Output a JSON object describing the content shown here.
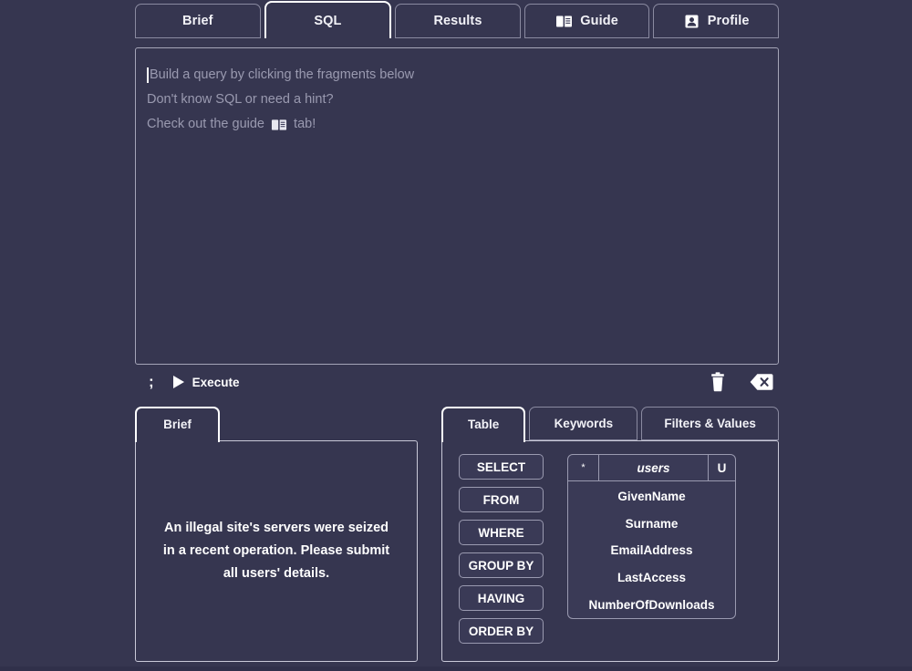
{
  "top_tabs": [
    {
      "label": "Brief",
      "icon": "",
      "active": false
    },
    {
      "label": "SQL",
      "icon": "",
      "active": true
    },
    {
      "label": "Results",
      "icon": "",
      "active": false
    },
    {
      "label": "Guide",
      "icon": "open-book-icon",
      "active": false
    },
    {
      "label": "Profile",
      "icon": "person-badge-icon",
      "active": false
    }
  ],
  "editor": {
    "placeholder_lines": [
      "Build a query by clicking the fragments below",
      "Don't know SQL or need a hint?",
      "Check out the guide "
    ],
    "guide_line_suffix": " tab!",
    "caret_visible": true
  },
  "toolbar": {
    "semicolon_label": ";",
    "execute_label": "Execute",
    "play_icon": "play-icon",
    "clear_icon": "trash-icon",
    "backspace_icon": "backspace-icon"
  },
  "brief_panel": {
    "tab_label": "Brief",
    "text": "An illegal site's servers were seized in a recent operation. Please submit all users' details."
  },
  "fragments_panel": {
    "tabs": [
      {
        "label": "Table",
        "active": true
      },
      {
        "label": "Keywords",
        "active": false
      },
      {
        "label": "Filters & Values",
        "active": false
      }
    ],
    "keywords": [
      "SELECT",
      "FROM",
      "WHERE",
      "GROUP BY",
      "HAVING",
      "ORDER BY"
    ],
    "table": {
      "star_label": "*",
      "name": "users",
      "alias": "U",
      "columns": [
        "GivenName",
        "Surname",
        "EmailAddress",
        "LastAccess",
        "NumberOfDownloads"
      ]
    }
  },
  "colors": {
    "background": "#363650",
    "panel_border": "#c9c9d8",
    "tab_border_inactive": "#8a8aa0",
    "tab_border_active": "#ffffff",
    "text": "#ffffff",
    "placeholder_text": "#9a9ab0",
    "fragment_bg": "#3a3a56"
  }
}
